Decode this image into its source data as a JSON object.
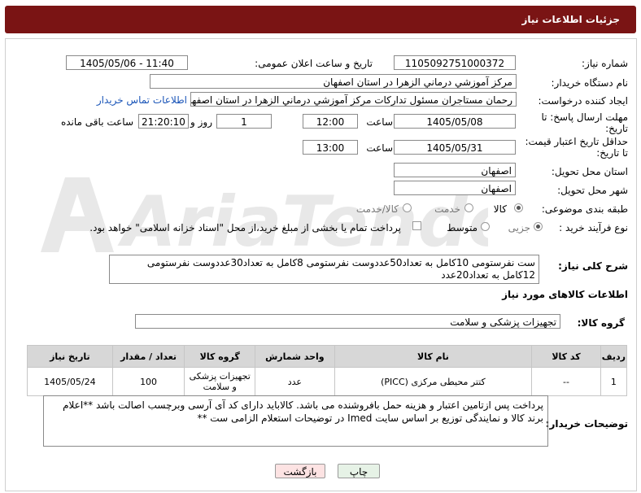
{
  "header": {
    "title": "جزئیات اطلاعات نیاز"
  },
  "form": {
    "need_number_label": "شماره نیاز:",
    "need_number": "1105092751000372",
    "announce_label": "تاریخ و ساعت اعلان عمومی:",
    "announce_value": "1405/05/06 - 11:40",
    "buyer_org_label": "نام دستگاه خریدار:",
    "buyer_org": "مرکز آموزشي درماني الزهرا در استان اصفهان",
    "creator_label": "ایجاد کننده درخواست:",
    "creator": "رحمان مستاجران مسئول تدارکات مرکز آموزشي درماني الزهرا در استان اصفهان",
    "contact_link": "اطلاعات تماس خریدار",
    "deadline_label": "مهلت ارسال پاسخ: تا تاریخ:",
    "deadline_date": "1405/05/08",
    "time_label": "ساعت",
    "deadline_time": "12:00",
    "days_value": "1",
    "days_label": "روز و",
    "remaining_time": "21:20:10",
    "remaining_label": "ساعت باقی مانده",
    "price_label": "حداقل تاریخ اعتبار قیمت: تا تاریخ:",
    "price_date": "1405/05/31",
    "price_time": "13:00",
    "province_label": "استان محل تحویل:",
    "province": "اصفهان",
    "city_label": "شهر محل تحویل:",
    "city": "اصفهان",
    "category_label": "طبقه بندی موضوعی:",
    "category_options": [
      "کالا",
      "خدمت",
      "کالا/خدمت"
    ],
    "category_selected": "کالا",
    "process_label": "نوع فرآیند خرید :",
    "process_options": [
      "جزیی",
      "متوسط"
    ],
    "process_selected": "جزیی",
    "payment_note": "پرداخت تمام یا بخشی از مبلغ خرید،از محل \"اسناد خزانه اسلامی\" خواهد بود."
  },
  "description": {
    "label": "شرح کلی نیاز:",
    "text": "ست نفرستومی 10کامل به تعداد50عددوست نفرستومی 8کامل به تعداد30عددوست نفرستومی 12کامل به تعداد20عدد"
  },
  "goods": {
    "section_title": "اطلاعات کالاهای مورد نیاز",
    "group_label": "گروه کالا:",
    "group_value": "تجهیزات پزشکی و سلامت",
    "columns": [
      "ردیف",
      "کد کالا",
      "نام کالا",
      "واحد شمارش",
      "گروه کالا",
      "تعداد / مقدار",
      "تاریخ نیاز"
    ],
    "rows": [
      {
        "row": "1",
        "code": "--",
        "name": "کتتر محیطی مرکزی (PICC)",
        "unit": "عدد",
        "group": "تجهیزات پزشکی و سلامت",
        "qty": "100",
        "date": "1405/05/24"
      }
    ]
  },
  "buyer_notes": {
    "label": "توضیحات خریدار:",
    "text": "پرداخت پس ازتامین اعتبار و هزینه حمل بافروشنده می باشد. کالاباید دارای کد آی آرسی وبرچسب اصالت باشد **اعلام برند کالا و نمایندگی توزیع بر اساس سایت Imed در توضیحات استعلام الزامی ست **"
  },
  "buttons": {
    "print": "چاپ",
    "back": "بازگشت"
  },
  "watermark": {
    "text": "AriaTender.net"
  },
  "colors": {
    "header": "#7a1414",
    "link": "#1a55b8",
    "table_head": "#d7d7d7"
  }
}
